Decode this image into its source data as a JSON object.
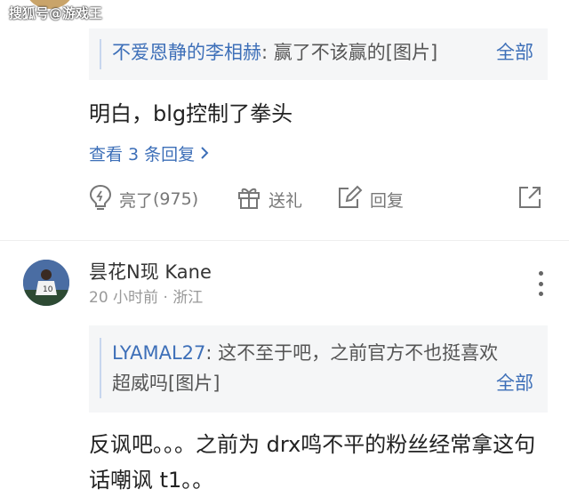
{
  "watermark": "搜狐号@游戏王",
  "comment1": {
    "quote": {
      "user": "不爱恩静的李相赫",
      "separator": ": ",
      "text": "赢了不该赢的[图片]",
      "all_label": "全部"
    },
    "reply": "明白，blg控制了拳头",
    "view_replies": "查看 3 条回复",
    "actions": {
      "like_label": "亮了",
      "like_count": "(975)",
      "gift_label": "送礼",
      "reply_label": "回复"
    },
    "icons": [
      "bulb-icon",
      "gift-icon",
      "edit-icon",
      "share-icon"
    ]
  },
  "comment2": {
    "username": "昙花N现 Kane",
    "meta": "20 小时前 · 浙江",
    "quote": {
      "user": "LYAMAL27",
      "separator": ": ",
      "text": "这不至于吧，之前官方不也挺喜欢超威吗[图片]",
      "all_label": "全部"
    },
    "reply": "反讽吧。。。之前为 drx鸣不平的粉丝经常拿这句话嘲讽 t1。。"
  },
  "colors": {
    "link": "#3d6fb8",
    "quote_bg": "#f5f6f7",
    "muted": "#999999"
  }
}
